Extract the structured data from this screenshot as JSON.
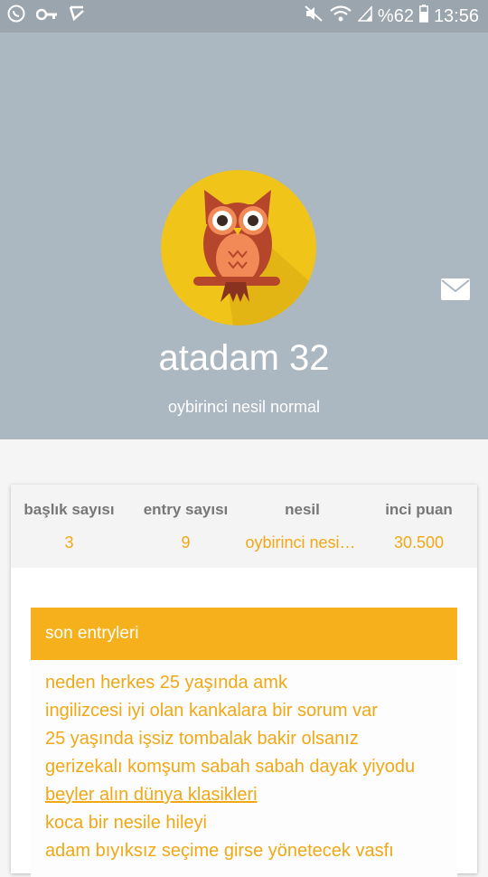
{
  "status_bar": {
    "battery": "%62",
    "time": "13:56",
    "icons": [
      "whatsapp-icon",
      "key-icon",
      "checkmark-notification-icon",
      "mute-icon",
      "wifi-icon",
      "signal-icon",
      "battery-icon"
    ]
  },
  "profile": {
    "name": "atadam 32",
    "subtitle": "oybirinci nesil normal",
    "avatar": "owl-avatar",
    "mail_icon": "mail-icon"
  },
  "stats": [
    {
      "label": "başlık sayısı",
      "value": "3"
    },
    {
      "label": "entry sayısı",
      "value": "9"
    },
    {
      "label": "nesil",
      "value": "oybirinci nesil normal"
    },
    {
      "label": "inci puan",
      "value": "30.500"
    }
  ],
  "entries_section": {
    "title": "son entryleri",
    "items": [
      "neden herkes 25 yaşında amk",
      "ingilizcesi iyi olan kankalara bir sorum var",
      "25 yaşında işsiz tombalak bakir olsanız",
      "gerizekalı komşum sabah sabah dayak yiyodu",
      "beyler alın dünya klasikleri",
      "koca bir nesile hileyi",
      "adam bıyıksız seçime girse yönetecek vasfı"
    ]
  },
  "colors": {
    "header_bg": "#abb8c1",
    "accent": "#f5b01c",
    "accent_text": "#f0a817",
    "avatar_bg": "#f0c419"
  }
}
